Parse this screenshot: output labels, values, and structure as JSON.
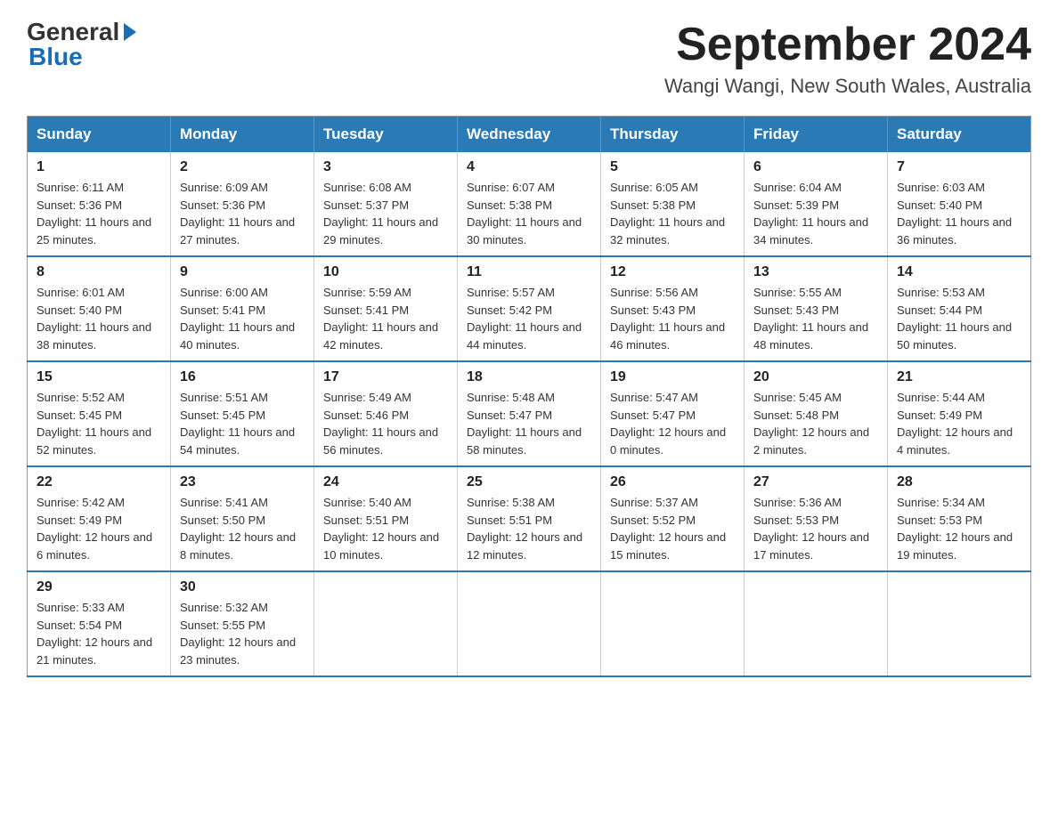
{
  "logo": {
    "general": "General",
    "blue": "Blue"
  },
  "header": {
    "month_title": "September 2024",
    "location": "Wangi Wangi, New South Wales, Australia"
  },
  "weekdays": [
    "Sunday",
    "Monday",
    "Tuesday",
    "Wednesday",
    "Thursday",
    "Friday",
    "Saturday"
  ],
  "weeks": [
    [
      {
        "day": "1",
        "sunrise": "6:11 AM",
        "sunset": "5:36 PM",
        "daylight": "11 hours and 25 minutes."
      },
      {
        "day": "2",
        "sunrise": "6:09 AM",
        "sunset": "5:36 PM",
        "daylight": "11 hours and 27 minutes."
      },
      {
        "day": "3",
        "sunrise": "6:08 AM",
        "sunset": "5:37 PM",
        "daylight": "11 hours and 29 minutes."
      },
      {
        "day": "4",
        "sunrise": "6:07 AM",
        "sunset": "5:38 PM",
        "daylight": "11 hours and 30 minutes."
      },
      {
        "day": "5",
        "sunrise": "6:05 AM",
        "sunset": "5:38 PM",
        "daylight": "11 hours and 32 minutes."
      },
      {
        "day": "6",
        "sunrise": "6:04 AM",
        "sunset": "5:39 PM",
        "daylight": "11 hours and 34 minutes."
      },
      {
        "day": "7",
        "sunrise": "6:03 AM",
        "sunset": "5:40 PM",
        "daylight": "11 hours and 36 minutes."
      }
    ],
    [
      {
        "day": "8",
        "sunrise": "6:01 AM",
        "sunset": "5:40 PM",
        "daylight": "11 hours and 38 minutes."
      },
      {
        "day": "9",
        "sunrise": "6:00 AM",
        "sunset": "5:41 PM",
        "daylight": "11 hours and 40 minutes."
      },
      {
        "day": "10",
        "sunrise": "5:59 AM",
        "sunset": "5:41 PM",
        "daylight": "11 hours and 42 minutes."
      },
      {
        "day": "11",
        "sunrise": "5:57 AM",
        "sunset": "5:42 PM",
        "daylight": "11 hours and 44 minutes."
      },
      {
        "day": "12",
        "sunrise": "5:56 AM",
        "sunset": "5:43 PM",
        "daylight": "11 hours and 46 minutes."
      },
      {
        "day": "13",
        "sunrise": "5:55 AM",
        "sunset": "5:43 PM",
        "daylight": "11 hours and 48 minutes."
      },
      {
        "day": "14",
        "sunrise": "5:53 AM",
        "sunset": "5:44 PM",
        "daylight": "11 hours and 50 minutes."
      }
    ],
    [
      {
        "day": "15",
        "sunrise": "5:52 AM",
        "sunset": "5:45 PM",
        "daylight": "11 hours and 52 minutes."
      },
      {
        "day": "16",
        "sunrise": "5:51 AM",
        "sunset": "5:45 PM",
        "daylight": "11 hours and 54 minutes."
      },
      {
        "day": "17",
        "sunrise": "5:49 AM",
        "sunset": "5:46 PM",
        "daylight": "11 hours and 56 minutes."
      },
      {
        "day": "18",
        "sunrise": "5:48 AM",
        "sunset": "5:47 PM",
        "daylight": "11 hours and 58 minutes."
      },
      {
        "day": "19",
        "sunrise": "5:47 AM",
        "sunset": "5:47 PM",
        "daylight": "12 hours and 0 minutes."
      },
      {
        "day": "20",
        "sunrise": "5:45 AM",
        "sunset": "5:48 PM",
        "daylight": "12 hours and 2 minutes."
      },
      {
        "day": "21",
        "sunrise": "5:44 AM",
        "sunset": "5:49 PM",
        "daylight": "12 hours and 4 minutes."
      }
    ],
    [
      {
        "day": "22",
        "sunrise": "5:42 AM",
        "sunset": "5:49 PM",
        "daylight": "12 hours and 6 minutes."
      },
      {
        "day": "23",
        "sunrise": "5:41 AM",
        "sunset": "5:50 PM",
        "daylight": "12 hours and 8 minutes."
      },
      {
        "day": "24",
        "sunrise": "5:40 AM",
        "sunset": "5:51 PM",
        "daylight": "12 hours and 10 minutes."
      },
      {
        "day": "25",
        "sunrise": "5:38 AM",
        "sunset": "5:51 PM",
        "daylight": "12 hours and 12 minutes."
      },
      {
        "day": "26",
        "sunrise": "5:37 AM",
        "sunset": "5:52 PM",
        "daylight": "12 hours and 15 minutes."
      },
      {
        "day": "27",
        "sunrise": "5:36 AM",
        "sunset": "5:53 PM",
        "daylight": "12 hours and 17 minutes."
      },
      {
        "day": "28",
        "sunrise": "5:34 AM",
        "sunset": "5:53 PM",
        "daylight": "12 hours and 19 minutes."
      }
    ],
    [
      {
        "day": "29",
        "sunrise": "5:33 AM",
        "sunset": "5:54 PM",
        "daylight": "12 hours and 21 minutes."
      },
      {
        "day": "30",
        "sunrise": "5:32 AM",
        "sunset": "5:55 PM",
        "daylight": "12 hours and 23 minutes."
      },
      null,
      null,
      null,
      null,
      null
    ]
  ],
  "labels": {
    "sunrise": "Sunrise:",
    "sunset": "Sunset:",
    "daylight": "Daylight:"
  }
}
